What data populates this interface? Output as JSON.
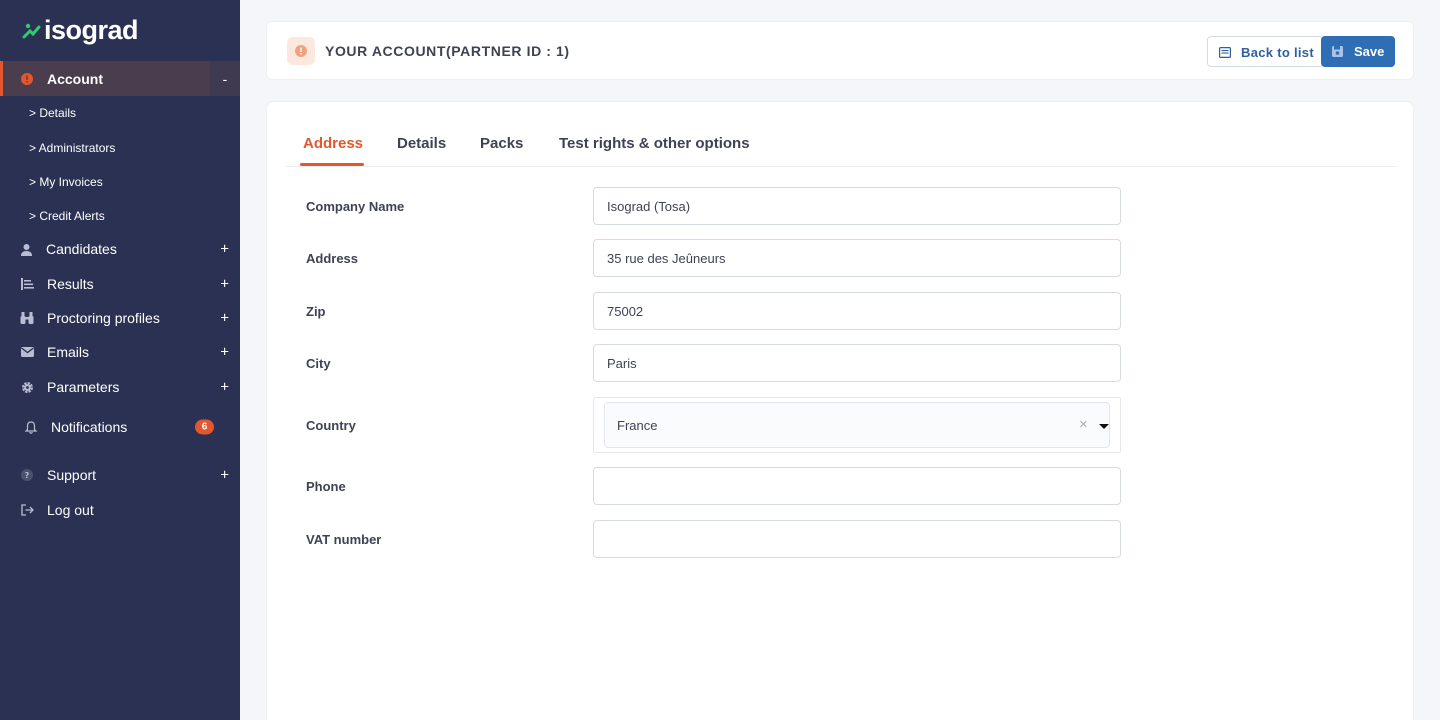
{
  "brand": {
    "name": "isograd"
  },
  "sidebar": {
    "account": {
      "label": "Account",
      "toggle": "-"
    },
    "subitems": [
      "> Details",
      "> Administrators",
      "> My Invoices",
      "> Credit Alerts"
    ],
    "items": [
      {
        "label": "Candidates",
        "icon": "user-icon",
        "toggle": "+"
      },
      {
        "label": "Results",
        "icon": "results-list-icon",
        "toggle": "+"
      },
      {
        "label": "Proctoring profiles",
        "icon": "binoculars-icon",
        "toggle": "+"
      },
      {
        "label": "Emails",
        "icon": "envelope-icon",
        "toggle": "+"
      },
      {
        "label": "Parameters",
        "icon": "gear-icon",
        "toggle": "+"
      }
    ],
    "notifications": {
      "label": "Notifications",
      "count": "6"
    },
    "support": {
      "label": "Support",
      "toggle": "+"
    },
    "logout": {
      "label": "Log out"
    }
  },
  "header": {
    "title": "YOUR ACCOUNT(PARTNER ID : 1)",
    "back_label": "Back to list",
    "save_label": "Save"
  },
  "tabs": [
    "Address",
    "Details",
    "Packs",
    "Test rights & other options"
  ],
  "form": {
    "company_name": {
      "label": "Company Name",
      "value": "Isograd (Tosa)"
    },
    "address": {
      "label": "Address",
      "value": "35 rue des Jeûneurs"
    },
    "zip": {
      "label": "Zip",
      "value": "75002"
    },
    "city": {
      "label": "City",
      "value": "Paris"
    },
    "country": {
      "label": "Country",
      "value": "France",
      "clear": "×"
    },
    "phone": {
      "label": "Phone",
      "value": ""
    },
    "vat": {
      "label": "VAT number",
      "value": ""
    }
  },
  "colors": {
    "accent": "#e4572e",
    "sidebar": "#2a3152",
    "primary": "#2f6db5"
  }
}
